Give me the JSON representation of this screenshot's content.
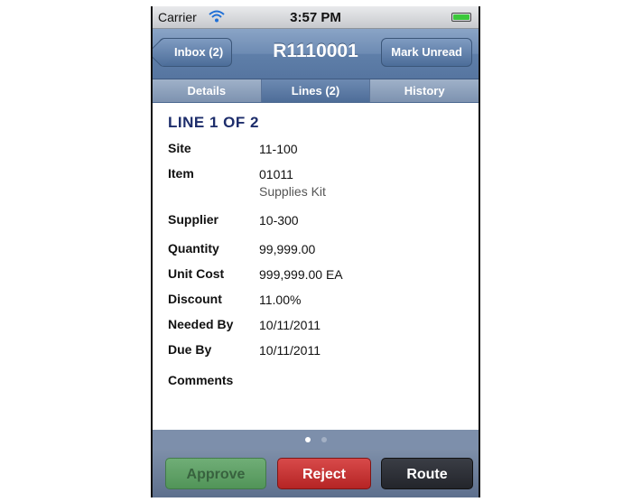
{
  "status_bar": {
    "carrier": "Carrier",
    "time": "3:57 PM",
    "wifi_icon": "wifi-icon",
    "battery_icon": "battery-icon"
  },
  "nav": {
    "back_label": "Inbox (2)",
    "title": "R1110001",
    "right_label": "Mark Unread"
  },
  "tabs": [
    {
      "label": "Details",
      "active": false
    },
    {
      "label": "Lines (2)",
      "active": true
    },
    {
      "label": "History",
      "active": false
    }
  ],
  "detail": {
    "heading": "LINE 1 OF 2",
    "fields": [
      {
        "label": "Site",
        "value": "11-100"
      },
      {
        "label": "Item",
        "value": "01011",
        "sub": "Supplies Kit"
      },
      {
        "label": "Supplier",
        "value": "10-300"
      },
      {
        "label": "Quantity",
        "value": "99,999.00"
      },
      {
        "label": "Unit Cost",
        "value": "999,999.00 EA"
      },
      {
        "label": "Discount",
        "value": "11.00%"
      },
      {
        "label": "Needed By",
        "value": "10/11/2011"
      },
      {
        "label": "Due By",
        "value": "10/11/2011"
      },
      {
        "label": "Comments",
        "value": ""
      }
    ]
  },
  "pager": {
    "current": 1,
    "total": 2
  },
  "actions": {
    "approve": "Approve",
    "reject": "Reject",
    "route": "Route"
  },
  "colors": {
    "nav_blue": "#6d8bb3",
    "heading_navy": "#1d2d6b",
    "approve_green": "#4f9a4f",
    "reject_red": "#b52424",
    "route_dark": "#23252b"
  }
}
